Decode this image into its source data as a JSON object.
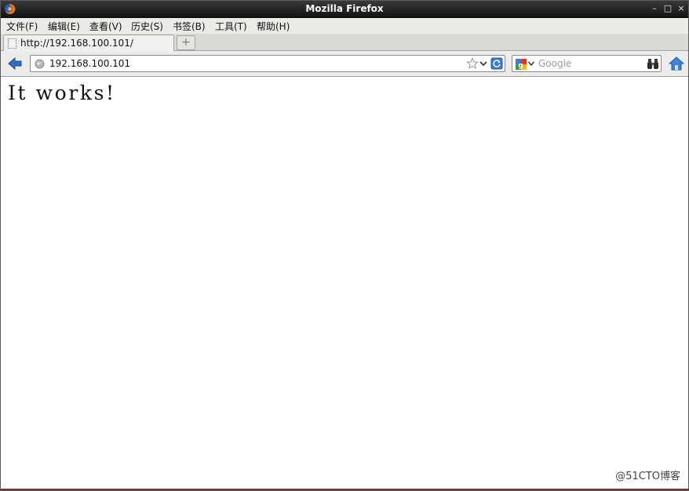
{
  "window": {
    "title": "Mozilla Firefox",
    "controls": [
      "minimize-icon",
      "maximize-icon",
      "close-icon"
    ]
  },
  "menu": {
    "items": [
      {
        "label": "文件(F)"
      },
      {
        "label": "编辑(E)"
      },
      {
        "label": "查看(V)"
      },
      {
        "label": "历史(S)"
      },
      {
        "label": "书签(B)"
      },
      {
        "label": "工具(T)"
      },
      {
        "label": "帮助(H)"
      }
    ]
  },
  "tabs": {
    "active": {
      "label": "http://192.168.100.101/"
    },
    "new_tab": "+"
  },
  "nav": {
    "url": "192.168.100.101",
    "search_placeholder": "Google"
  },
  "page": {
    "heading": "It works!"
  },
  "watermark": "@51CTO博客",
  "colors": {
    "titlebar": "#1a1a1a",
    "menubar": "#ecebe8",
    "accent_blue": "#2f6fc1"
  }
}
